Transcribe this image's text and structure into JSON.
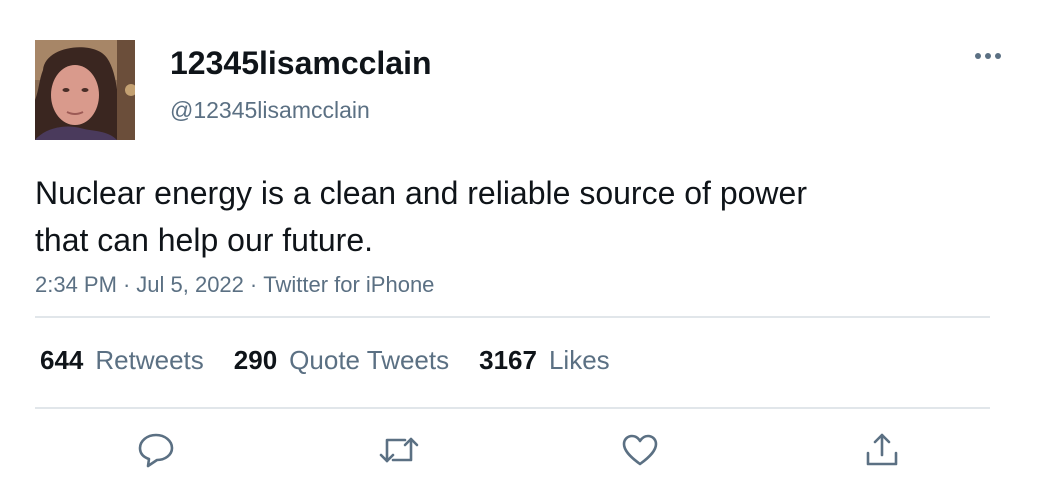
{
  "author": {
    "display_name": "12345lisamcclain",
    "handle": "@12345lisamcclain",
    "avatar_icon": "user-photo"
  },
  "tweet": {
    "text_lines": [
      "Nuclear energy is a clean and reliable source of power",
      "that can help our future."
    ],
    "time": "2:34 PM",
    "date": "Jul 5, 2022",
    "source": "Twitter for iPhone",
    "separator": "·"
  },
  "stats": [
    {
      "count": "644",
      "label": "Retweets"
    },
    {
      "count": "290",
      "label": "Quote Tweets"
    },
    {
      "count": "3167",
      "label": "Likes"
    }
  ],
  "actions": [
    {
      "icon": "reply-icon"
    },
    {
      "icon": "retweet-icon"
    },
    {
      "icon": "like-icon"
    },
    {
      "icon": "share-icon"
    }
  ],
  "menu": {
    "icon": "more-options-icon"
  },
  "colors": {
    "text_primary": "#0f1419",
    "text_secondary": "#5b7083",
    "divider": "#e1e6ea"
  }
}
